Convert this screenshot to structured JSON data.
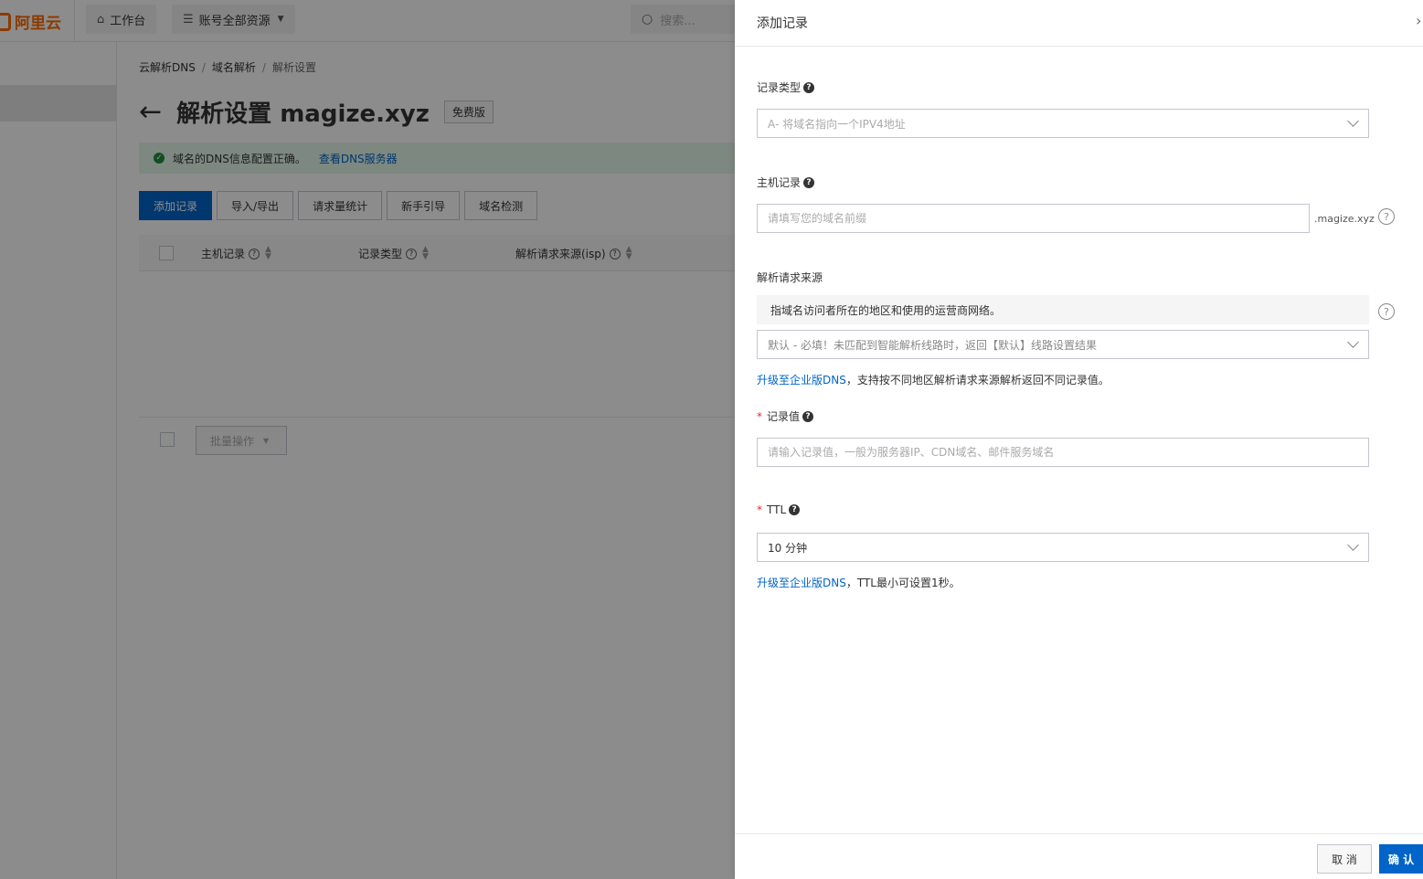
{
  "topbar": {
    "logo_text": "阿里云",
    "workbench_label": "工作台",
    "resources_label": "账号全部资源",
    "search_placeholder": "搜索..."
  },
  "breadcrumb": {
    "items": [
      "云解析DNS",
      "域名解析",
      "解析设置"
    ]
  },
  "page": {
    "title": "解析设置 magize.xyz",
    "badge": "免费版",
    "notice_text": "域名的DNS信息配置正确。",
    "notice_link": "查看DNS服务器"
  },
  "toolbar": {
    "add_record": "添加记录",
    "import_export": "导入/导出",
    "request_stats": "请求量统计",
    "guide": "新手引导",
    "domain_check": "域名检测"
  },
  "table": {
    "columns": [
      "主机记录",
      "记录类型",
      "解析请求来源(isp)"
    ],
    "batch_label": "批量操作"
  },
  "drawer": {
    "title": "添加记录",
    "record_type": {
      "label": "记录类型",
      "value": "A- 将域名指向一个IPV4地址"
    },
    "host_record": {
      "label": "主机记录",
      "placeholder": "请填写您的域名前缀",
      "suffix": ".magize.xyz"
    },
    "source": {
      "label": "解析请求来源",
      "hint": "指域名访问者所在的地区和使用的运营商网络。",
      "value": "默认 - 必填！未匹配到智能解析线路时，返回【默认】线路设置结果",
      "tip_link": "升级至企业版DNS",
      "tip_text": "，支持按不同地区解析请求来源解析返回不同记录值。"
    },
    "record_value": {
      "required_mark": "*",
      "label": "记录值",
      "placeholder": "请输入记录值，一般为服务器IP、CDN域名、邮件服务域名"
    },
    "ttl": {
      "required_mark": "*",
      "label": "TTL",
      "value": "10 分钟",
      "tip_link": "升级至企业版DNS",
      "tip_text": "，TTL最小可设置1秒。"
    },
    "cancel_label": "取 消",
    "confirm_label": "确 认"
  }
}
